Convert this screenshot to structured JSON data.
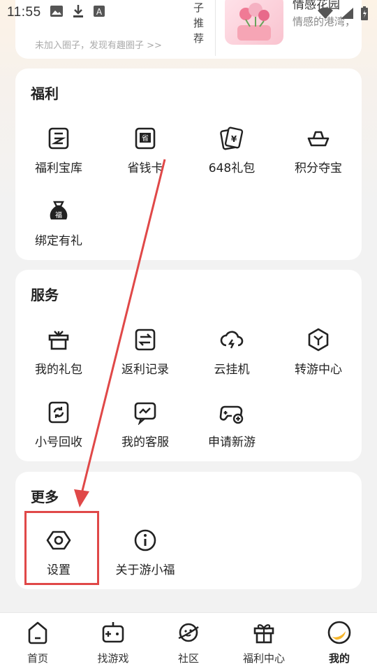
{
  "status_bar": {
    "time": "11:55",
    "icons": [
      "image-icon",
      "download-icon",
      "a-icon",
      "wifi-icon",
      "signal-icon",
      "battery-icon"
    ]
  },
  "top_card": {
    "hint": "未加入圈子，发现有趣圈子 >>",
    "vertical_text": [
      "子",
      "推",
      "荐"
    ],
    "recommend_title": "情感花园",
    "recommend_sub": "情感的港湾，"
  },
  "welfare": {
    "title": "福利",
    "items": [
      {
        "label": "福利宝库",
        "icon": "welfare-vault-icon"
      },
      {
        "label": "省钱卡",
        "icon": "save-money-card-icon"
      },
      {
        "label": "648礼包",
        "icon": "gift-card-icon"
      },
      {
        "label": "积分夺宝",
        "icon": "ingot-icon"
      },
      {
        "label": "绑定有礼",
        "icon": "fortune-bag-icon"
      }
    ]
  },
  "service": {
    "title": "服务",
    "items": [
      {
        "label": "我的礼包",
        "icon": "gift-box-icon"
      },
      {
        "label": "返利记录",
        "icon": "rebate-record-icon"
      },
      {
        "label": "云挂机",
        "icon": "cloud-hangup-icon"
      },
      {
        "label": "转游中心",
        "icon": "transfer-game-icon"
      },
      {
        "label": "小号回收",
        "icon": "recycle-icon"
      },
      {
        "label": "我的客服",
        "icon": "customer-service-icon"
      },
      {
        "label": "申请新游",
        "icon": "gamepad-add-icon"
      }
    ]
  },
  "more": {
    "title": "更多",
    "items": [
      {
        "label": "设置",
        "icon": "settings-icon"
      },
      {
        "label": "关于游小福",
        "icon": "info-icon"
      }
    ]
  },
  "tabbar": {
    "items": [
      {
        "label": "首页",
        "icon": "home-icon"
      },
      {
        "label": "找游戏",
        "icon": "game-console-icon"
      },
      {
        "label": "社区",
        "icon": "planet-icon"
      },
      {
        "label": "福利中心",
        "icon": "gift-icon"
      },
      {
        "label": "我的",
        "icon": "profile-icon"
      }
    ],
    "active": "我的"
  },
  "colors": {
    "annotation_red": "#e04848",
    "card_bg": "#ffffff",
    "page_bg": "#f2f2f2"
  }
}
